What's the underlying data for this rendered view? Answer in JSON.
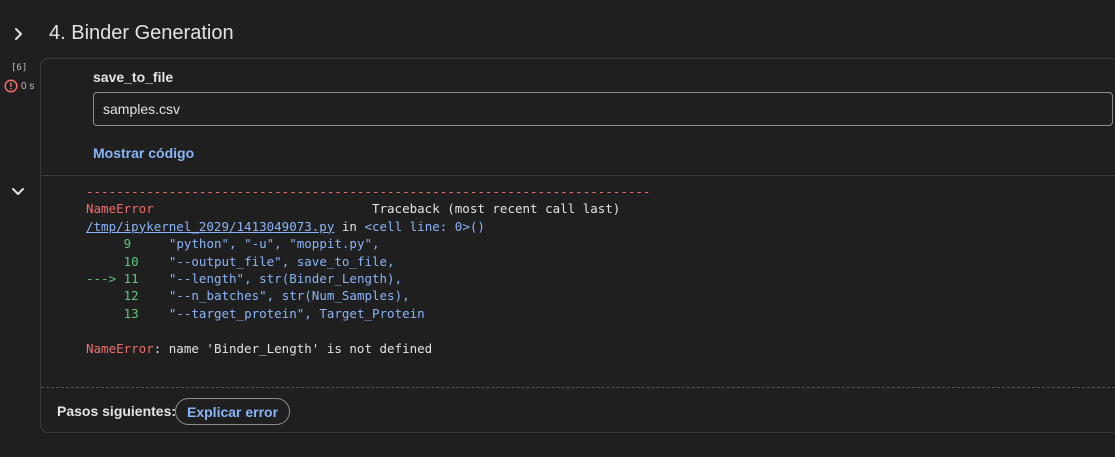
{
  "section": {
    "title": "4. Binder Generation"
  },
  "cell": {
    "exec_count": "[6]",
    "exec_time": "0 s",
    "form": {
      "label": "save_to_file",
      "value": "samples.csv"
    },
    "show_code_label": "Mostrar código"
  },
  "output": {
    "dash_line": "---------------------------------------------------------------------------",
    "error_name": "NameError",
    "traceback_heading": "Traceback (most recent call last)",
    "file_path": "/tmp/ipykernel_2029/1413049073.py",
    "in_word": "in",
    "cell_ref": "<cell line: 0>()",
    "code_lines": [
      {
        "marker": "",
        "num": "9",
        "code": "\"python\", \"-u\", \"moppit.py\","
      },
      {
        "marker": "",
        "num": "10",
        "code": "\"--output_file\", save_to_file,"
      },
      {
        "marker": "--->",
        "num": "11",
        "code": "\"--length\", str(Binder_Length),"
      },
      {
        "marker": "",
        "num": "12",
        "code": "\"--n_batches\", str(Num_Samples),"
      },
      {
        "marker": "",
        "num": "13",
        "code": "\"--target_protein\", Target_Protein"
      }
    ],
    "error_message": ": name 'Binder_Length' is not defined"
  },
  "next_steps": {
    "label": "Pasos siguientes:",
    "explain_button": "Explicar error"
  },
  "colors": {
    "background": "#1f1f1f",
    "error_red": "#f16e6e",
    "link_blue": "#8ab4f8",
    "line_green": "#5fc77a"
  },
  "icons": {
    "collapse": "chevron-right-icon",
    "output_toggle": "chevron-down-icon",
    "error": "error-circle-icon"
  }
}
